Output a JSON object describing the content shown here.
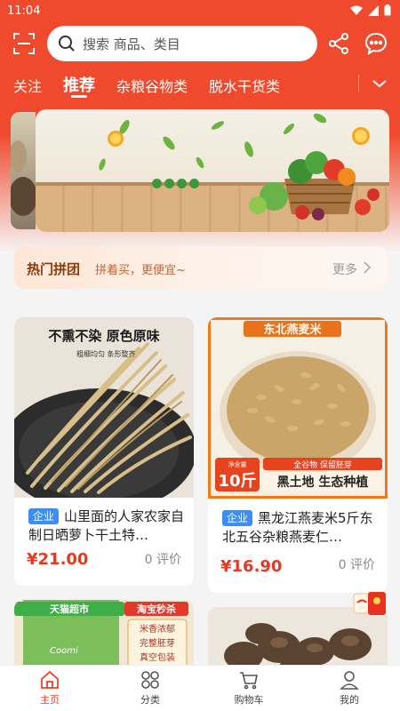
{
  "status_bar": {
    "time": "11:04"
  },
  "search": {
    "placeholder": "搜索 商品、类目"
  },
  "tabs": [
    "关注",
    "推荐",
    "杂粮谷物类",
    "脱水干货类"
  ],
  "active_tab": "推荐",
  "group_buy": {
    "title": "热门拼团",
    "subtitle": "拼着买，更便宜~",
    "more": "更多"
  },
  "products": [
    {
      "image_text": [
        "不熏不染 原色原味",
        "粗细均匀 条形整齐"
      ],
      "badge": "企业",
      "title": "山里面的人家农家自制日晒萝卜干土特…",
      "price": "¥21.00",
      "reviews": "0 评价"
    },
    {
      "image_text": [
        "东北燕麦米",
        "净含量",
        "10斤",
        "全谷物 保留胚芽",
        "黑土地 生态种植"
      ],
      "badge": "企业",
      "title": "黑龙江燕麦米5斤东北五谷杂粮燕麦仁…",
      "price": "¥16.90",
      "reviews": "0 评价"
    },
    {
      "image_text": [
        "天猫超市",
        "淘宝秒杀",
        "米香浓郁",
        "完整胚芽",
        "真空包装",
        "Coomi"
      ]
    },
    {
      "image_text": []
    }
  ],
  "bottom_nav": [
    {
      "label": "主页",
      "icon": "home-icon",
      "active": true
    },
    {
      "label": "分类",
      "icon": "category-icon",
      "active": false
    },
    {
      "label": "购物车",
      "icon": "cart-icon",
      "active": false
    },
    {
      "label": "我的",
      "icon": "user-icon",
      "active": false
    }
  ],
  "colors": {
    "brand_red": "#ef4a2e",
    "price_red": "#e53a22",
    "badge_blue": "#3d8ef0"
  }
}
